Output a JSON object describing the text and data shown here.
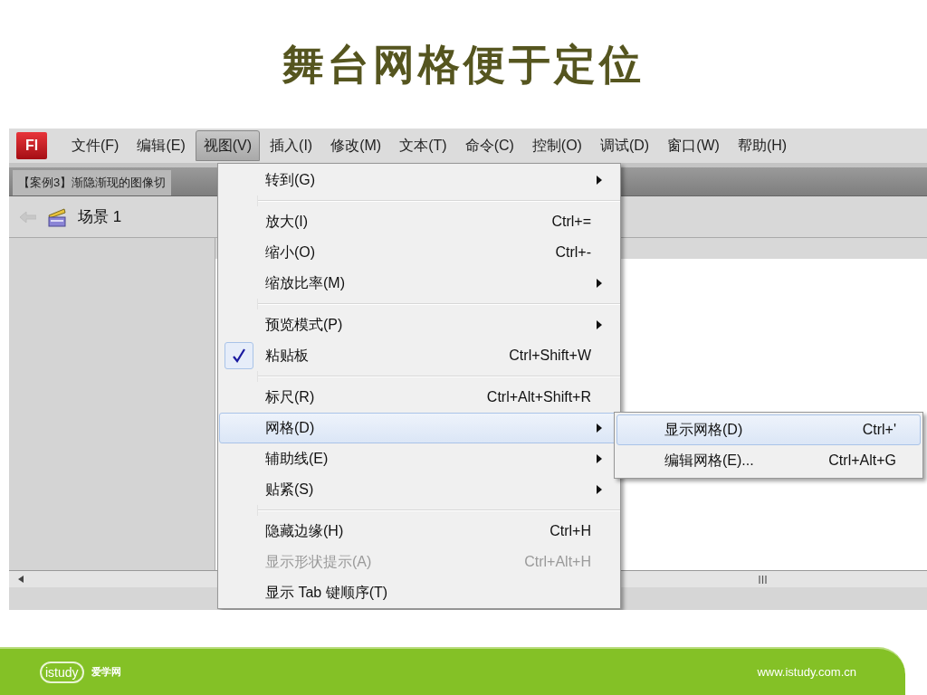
{
  "slide_title": "舞台网格便于定位",
  "app": {
    "logo": "Fl",
    "menu_bar": [
      {
        "label": "文件(F)",
        "selected": false
      },
      {
        "label": "编辑(E)",
        "selected": false
      },
      {
        "label": "视图(V)",
        "selected": true
      },
      {
        "label": "插入(I)",
        "selected": false
      },
      {
        "label": "修改(M)",
        "selected": false
      },
      {
        "label": "文本(T)",
        "selected": false
      },
      {
        "label": "命令(C)",
        "selected": false
      },
      {
        "label": "控制(O)",
        "selected": false
      },
      {
        "label": "调试(D)",
        "selected": false
      },
      {
        "label": "窗口(W)",
        "selected": false
      },
      {
        "label": "帮助(H)",
        "selected": false
      }
    ],
    "document_tab": "【案例3】渐隐渐现的图像切",
    "scene": "场景 1",
    "view_menu": [
      {
        "kind": "item",
        "label": "转到(G)",
        "submenu": true,
        "checked": false,
        "disabled": false,
        "selected": false
      },
      {
        "kind": "separator"
      },
      {
        "kind": "item",
        "label": "放大(I)",
        "shortcut": "Ctrl+=",
        "submenu": false,
        "checked": false,
        "disabled": false,
        "selected": false
      },
      {
        "kind": "item",
        "label": "缩小(O)",
        "shortcut": "Ctrl+-",
        "submenu": false,
        "checked": false,
        "disabled": false,
        "selected": false
      },
      {
        "kind": "item",
        "label": "缩放比率(M)",
        "submenu": true,
        "checked": false,
        "disabled": false,
        "selected": false
      },
      {
        "kind": "separator"
      },
      {
        "kind": "item",
        "label": "预览模式(P)",
        "submenu": true,
        "checked": false,
        "disabled": false,
        "selected": false
      },
      {
        "kind": "item",
        "label": "粘贴板",
        "shortcut": "Ctrl+Shift+W",
        "submenu": false,
        "checked": true,
        "disabled": false,
        "selected": false
      },
      {
        "kind": "separator"
      },
      {
        "kind": "item",
        "label": "标尺(R)",
        "shortcut": "Ctrl+Alt+Shift+R",
        "submenu": false,
        "checked": false,
        "disabled": false,
        "selected": false
      },
      {
        "kind": "item",
        "label": "网格(D)",
        "submenu": true,
        "checked": false,
        "disabled": false,
        "selected": true
      },
      {
        "kind": "item",
        "label": "辅助线(E)",
        "submenu": true,
        "checked": false,
        "disabled": false,
        "selected": false
      },
      {
        "kind": "item",
        "label": "贴紧(S)",
        "submenu": true,
        "checked": false,
        "disabled": false,
        "selected": false
      },
      {
        "kind": "separator"
      },
      {
        "kind": "item",
        "label": "隐藏边缘(H)",
        "shortcut": "Ctrl+H",
        "submenu": false,
        "checked": false,
        "disabled": false,
        "selected": false
      },
      {
        "kind": "item",
        "label": "显示形状提示(A)",
        "shortcut": "Ctrl+Alt+H",
        "submenu": false,
        "checked": false,
        "disabled": true,
        "selected": false
      },
      {
        "kind": "item",
        "label": "显示 Tab 键顺序(T)",
        "submenu": false,
        "checked": false,
        "disabled": false,
        "selected": false
      }
    ],
    "grid_submenu": [
      {
        "label": "显示网格(D)",
        "shortcut": "Ctrl+'",
        "selected": true
      },
      {
        "label": "编辑网格(E)...",
        "shortcut": "Ctrl+Alt+G",
        "selected": false
      }
    ]
  },
  "footer": {
    "logo": "istudy",
    "logo_caption": "爱学网",
    "url": "www.istudy.com.cn"
  }
}
